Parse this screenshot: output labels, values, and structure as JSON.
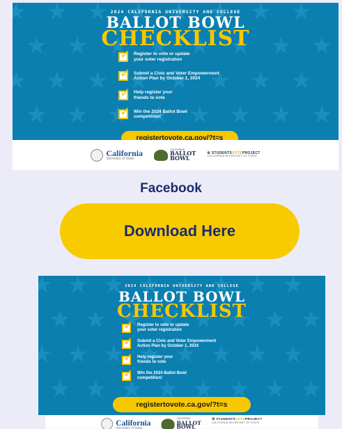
{
  "poster": {
    "eyebrow": "2024 CALIFORNIA UNIVERSITY AND COLLEGE",
    "title_line1": "BALLOT BOWL",
    "title_line2": "CHECKLIST",
    "checklist": [
      "Register to vote or update\nyour voter registration",
      "Submit a Civic and Voter Empowerment\nAction Plan by October 1, 2024",
      "Help register your\nfriends to vote",
      "Win the 2024 Ballot Bowl\ncompetition!"
    ],
    "check_glyph": "✓",
    "url": "registertovote.ca.gov/?t=s",
    "footer": {
      "california": "California",
      "secretary_of_state": "Secretary of State",
      "bowl_small": "CALIFORNIA",
      "bowl_line1": "BALLOT",
      "bowl_line2": "BOWL",
      "svp_students": "STUDENTS",
      "svp_votes": "VOTE",
      "svp_project": "PROJECT",
      "svp_sub": "CALIFORNIA SECRETARY OF STATE"
    }
  },
  "facebook_label": "Facebook",
  "download_button": "Download Here",
  "colors": {
    "page_bg": "#ececf8",
    "poster_blue": "#0b7fb0",
    "poster_yellow": "#f6c800",
    "button_yellow": "#f8cb00",
    "heading_navy": "#1d2b6e"
  }
}
